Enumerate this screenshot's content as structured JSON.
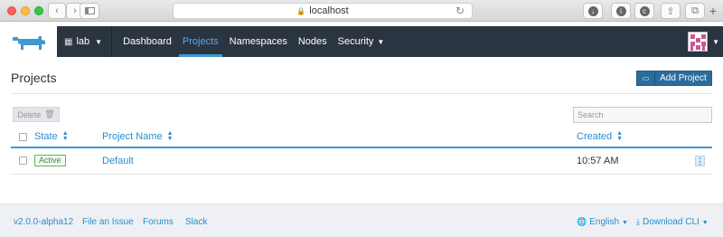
{
  "browser": {
    "url": "localhost"
  },
  "nav": {
    "environment": "lab",
    "items": [
      {
        "label": "Dashboard"
      },
      {
        "label": "Projects"
      },
      {
        "label": "Namespaces"
      },
      {
        "label": "Nodes"
      },
      {
        "label": "Security"
      }
    ],
    "active": "Projects"
  },
  "page": {
    "title": "Projects",
    "add_label": "Add Project",
    "delete_label": "Delete",
    "search_placeholder": "Search"
  },
  "table": {
    "columns": [
      "State",
      "Project Name",
      "Created"
    ],
    "rows": [
      {
        "state": "Active",
        "name": "Default",
        "created": "10:57 AM"
      }
    ]
  },
  "footer": {
    "version": "v2.0.0-alpha12",
    "issue": "File an Issue",
    "forums": "Forums",
    "slack": "Slack",
    "language": "English",
    "download": "Download CLI"
  },
  "colors": {
    "nav_bg": "#2b3441",
    "accent": "#3d98d3",
    "primary_button": "#2a6c9c",
    "active_badge": "#5cb85c"
  }
}
